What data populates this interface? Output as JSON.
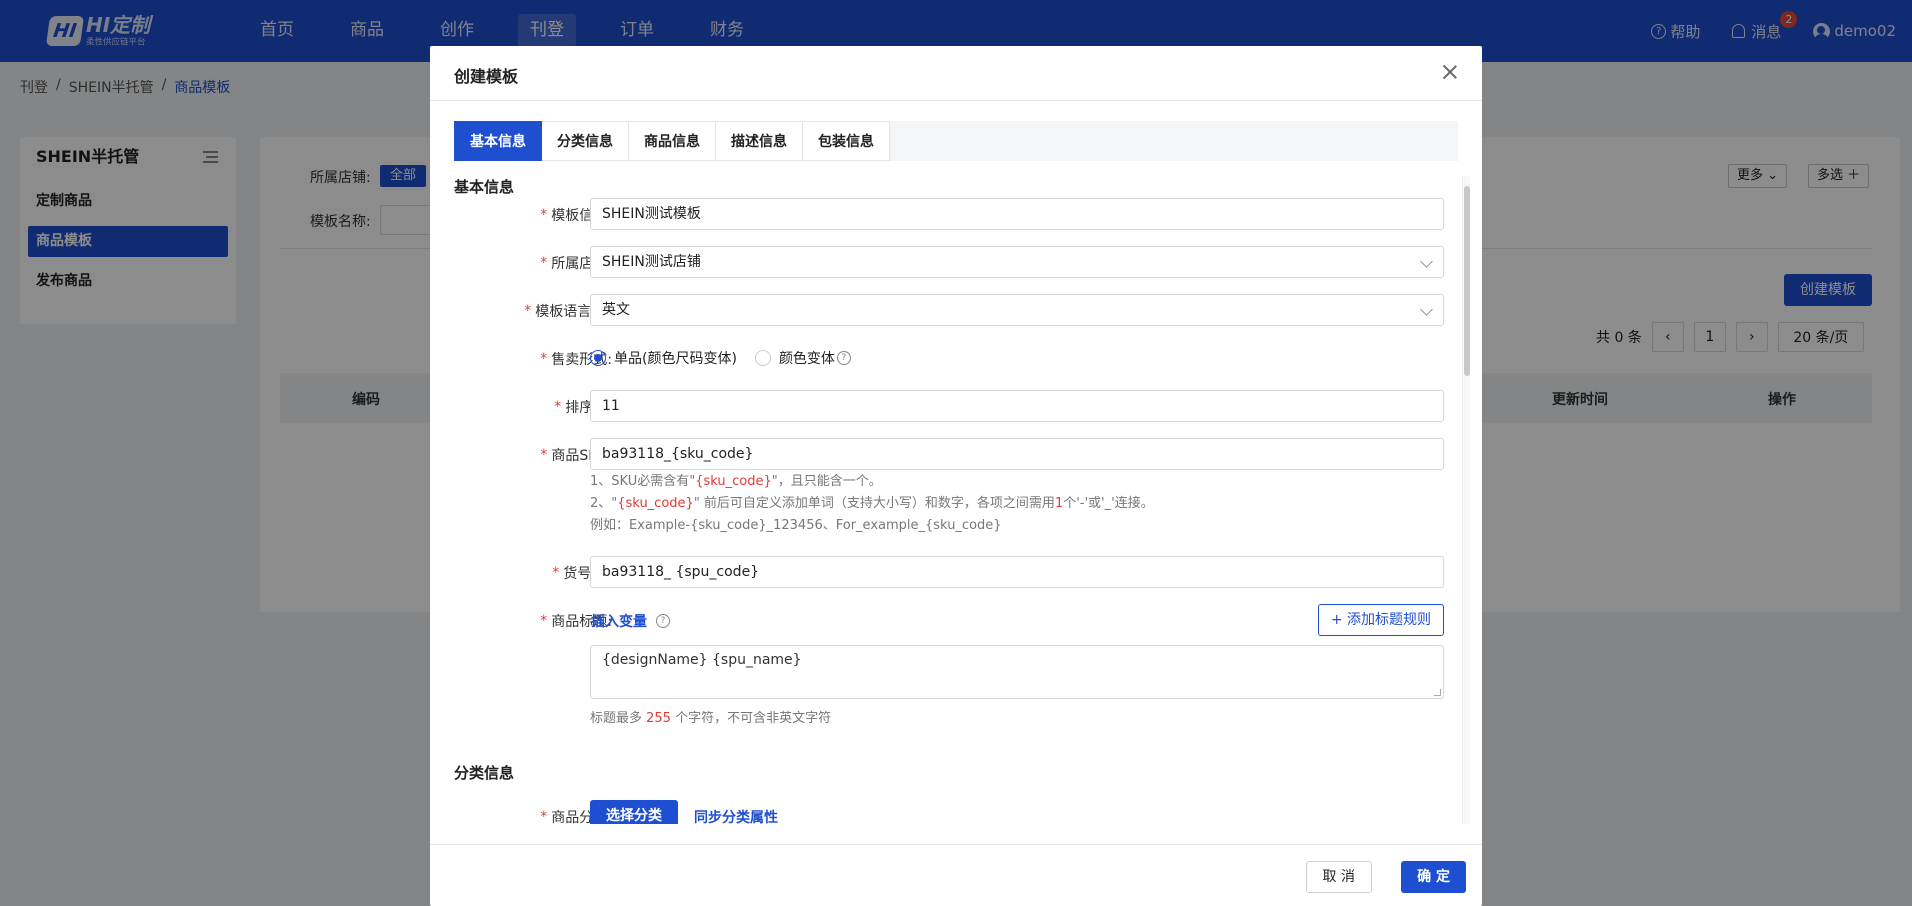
{
  "logo": {
    "mark": "HI",
    "name": "HI定制",
    "subtitle": "柔性供应链平台"
  },
  "nav": {
    "items": [
      {
        "label": "首页"
      },
      {
        "label": "商品"
      },
      {
        "label": "创作"
      },
      {
        "label": "刊登",
        "active": true
      },
      {
        "label": "订单"
      },
      {
        "label": "财务"
      }
    ],
    "help": "帮助",
    "messages": "消息",
    "message_count": "2",
    "username": "demo02"
  },
  "breadcrumb": [
    "刊登",
    "/",
    "SHEIN半托管",
    "/",
    "商品模板"
  ],
  "sidebar": {
    "title": "SHEIN半托管",
    "items": [
      {
        "label": "定制商品"
      },
      {
        "label": "商品模板",
        "active": true
      },
      {
        "label": "发布商品"
      }
    ]
  },
  "background": {
    "store_label": "所属店铺:",
    "store_tag": "全部",
    "template_name_label": "模板名称:",
    "more": "更多",
    "multi_select": "多选",
    "create_button": "创建模板",
    "total": "共 0 条",
    "page": "1",
    "page_size": "20 条/页",
    "columns": {
      "code": "编码",
      "updated": "更新时间",
      "action": "操作"
    }
  },
  "modal": {
    "title": "创建模板",
    "tabs": [
      "基本信息",
      "分类信息",
      "商品信息",
      "描述信息",
      "包装信息"
    ],
    "active_tab": 0,
    "basic_section": "基本信息",
    "fields": {
      "template_info": {
        "label": "模板信息:",
        "value": "SHEIN测试模板"
      },
      "store": {
        "label": "所属店铺:",
        "value": "SHEIN测试店铺"
      },
      "language": {
        "label": "模板语言",
        "value": "英文"
      },
      "sale_mode": {
        "label": "售卖形式:",
        "option1": "单品(颜色尺码变体)",
        "option2": "颜色变体",
        "selected": "option1"
      },
      "sort": {
        "label": "排序值:",
        "value": "11"
      },
      "sku": {
        "label": "商品SKU:",
        "value": "ba93118_{sku_code}",
        "hint1_pre": "1、SKU必需含有\"",
        "hint1_code": "{sku_code}",
        "hint1_post": "\"，且只能含一个。",
        "hint2_pre": "2、\"",
        "hint2_code": "{sku_code}",
        "hint2_mid": "\" 前后可自定义添加单词（支持大小写）和数字，各项之间需用",
        "hint2_num": "1",
        "hint2_post": "个'-'或'_'连接。",
        "hint3": "例如：Example-{sku_code}_123456、For_example_{sku_code}"
      },
      "item_no": {
        "label": "货号",
        "value": "ba93118_ {spu_code}"
      },
      "title": {
        "label": "商品标题:",
        "insert_var": "插入变量",
        "add_rule": "+ 添加标题规则",
        "value": "{designName} {spu_name}",
        "hint_pre": "标题最多 ",
        "hint_num": "255",
        "hint_post": " 个字符，不可含非英文字符"
      }
    },
    "category_section": "分类信息",
    "category": {
      "label": "商品分类:",
      "select": "选择分类",
      "sync": "同步分类属性"
    },
    "cancel": "取 消",
    "confirm": "确 定"
  }
}
